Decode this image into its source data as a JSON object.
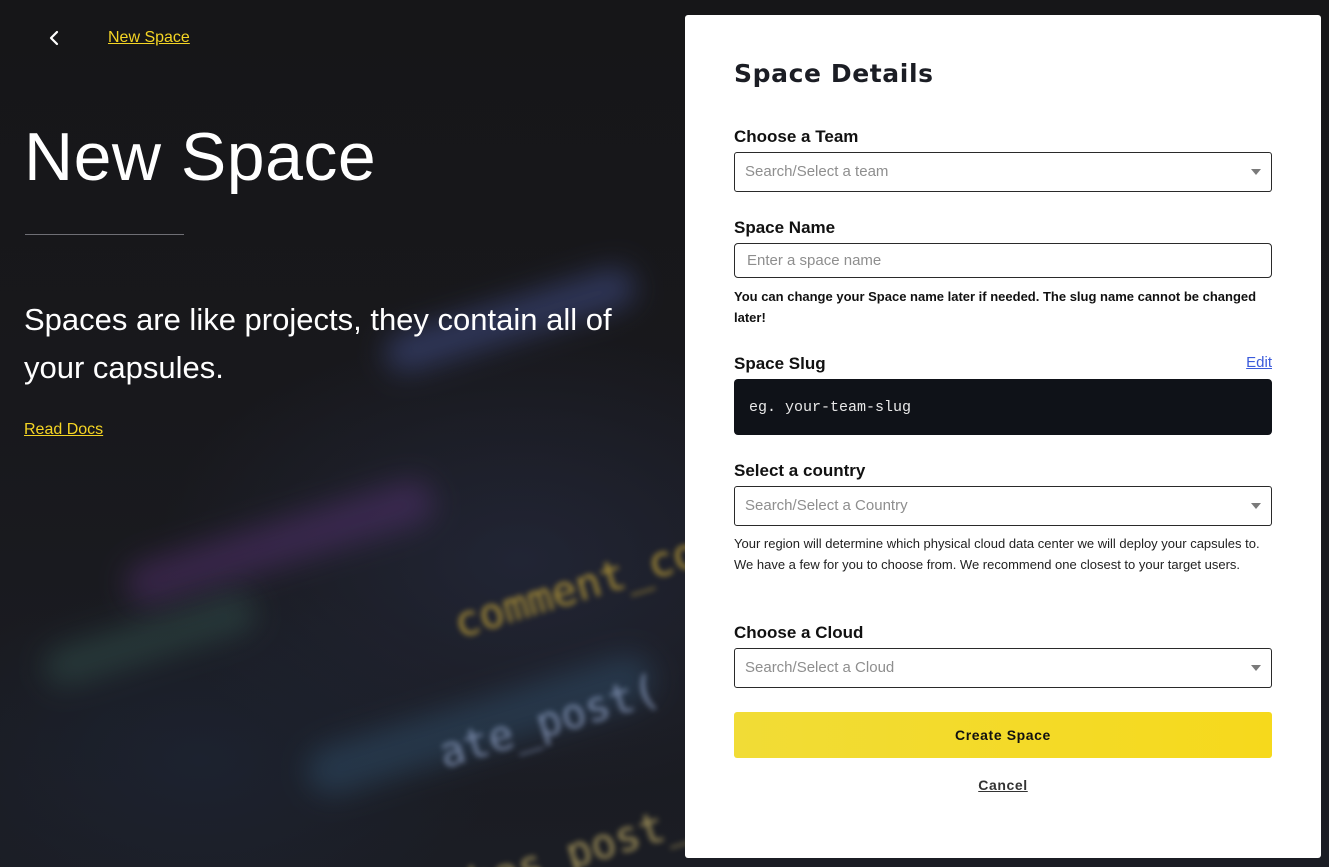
{
  "header": {
    "breadcrumb": "New Space"
  },
  "hero": {
    "title": "New Space",
    "description": "Spaces are like projects, they contain all of your capsules.",
    "read_docs_label": "Read Docs"
  },
  "background_code": {
    "line_1": "comment_count",
    "line_2": "ate_post(",
    "line_3": "has_post_"
  },
  "form": {
    "title": "Space Details",
    "team": {
      "label": "Choose a Team",
      "placeholder": "Search/Select a team"
    },
    "space_name": {
      "label": "Space Name",
      "placeholder": "Enter a space name",
      "value": "",
      "hint": "You can change your Space name later if needed. The slug name cannot be changed later!"
    },
    "space_slug": {
      "label": "Space Slug",
      "edit_label": "Edit",
      "placeholder": "eg. your-team-slug"
    },
    "country": {
      "label": "Select a country",
      "placeholder": "Search/Select a Country",
      "hint": "Your region will determine which physical cloud data center we will deploy your capsules to. We have a few for you to choose from. We recommend one closest to your target users."
    },
    "cloud": {
      "label": "Choose a Cloud",
      "placeholder": "Search/Select a Cloud"
    },
    "submit_label": "Create Space",
    "cancel_label": "Cancel"
  },
  "colors": {
    "accent": "#f5d524",
    "link_blue": "#3b5bdb",
    "slug_bg": "#0f1218"
  }
}
